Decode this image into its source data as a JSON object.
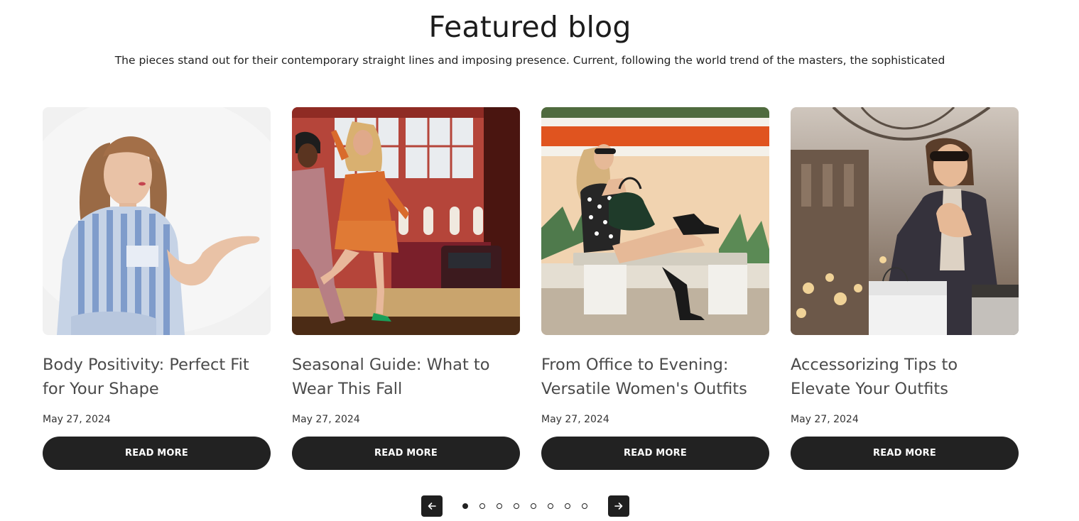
{
  "section": {
    "title": "Featured blog",
    "subtitle": "The pieces stand out for their contemporary straight lines and imposing presence. Current, following the world trend of the masters, the sophisticated"
  },
  "posts": [
    {
      "title": "Body Positivity: Perfect Fit for Your Shape",
      "date": "May 27, 2024",
      "button": "READ MORE",
      "image": "woman-striped-shirt-photo"
    },
    {
      "title": "Seasonal Guide: What to Wear This Fall",
      "date": "May 27, 2024",
      "button": "READ MORE",
      "image": "street-fashion-couple-photo"
    },
    {
      "title": "From Office to Evening: Versatile Women's Outfits",
      "date": "May 27, 2024",
      "button": "READ MORE",
      "image": "woman-on-bench-photo"
    },
    {
      "title": "Accessorizing Tips to Elevate Your Outfits",
      "date": "May 27, 2024",
      "button": "READ MORE",
      "image": "woman-shopping-bags-photo"
    }
  ],
  "pagination": {
    "prev_icon": "arrow-left-icon",
    "next_icon": "arrow-right-icon",
    "dot_count": 8,
    "active_dot": 1
  },
  "colors": {
    "button_bg": "#222222",
    "button_text": "#ffffff",
    "title": "#1c1c1c",
    "post_title": "#4a4a4a"
  }
}
